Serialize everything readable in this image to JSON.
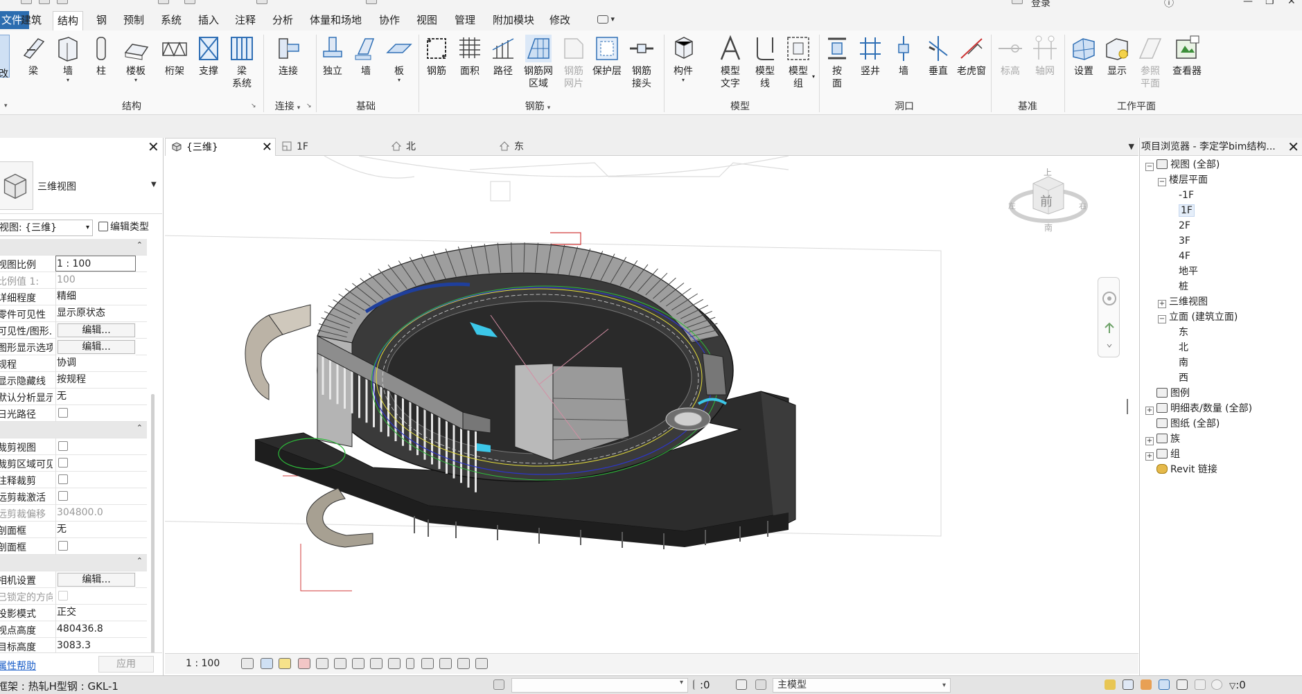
{
  "title_bar": {
    "login": "登录"
  },
  "ribbon_tabs": [
    {
      "label": "文件"
    },
    {
      "label": "建筑"
    },
    {
      "label": "结构"
    },
    {
      "label": "钢"
    },
    {
      "label": "预制"
    },
    {
      "label": "系统"
    },
    {
      "label": "插入"
    },
    {
      "label": "注释"
    },
    {
      "label": "分析"
    },
    {
      "label": "体量和场地"
    },
    {
      "label": "协作"
    },
    {
      "label": "视图"
    },
    {
      "label": "管理"
    },
    {
      "label": "附加模块"
    },
    {
      "label": "修改"
    }
  ],
  "active_tab": "结构",
  "ribbon": {
    "buttons": {
      "modify": "改",
      "beam": "梁",
      "wall": "墙",
      "column": "柱",
      "floor": "楼板",
      "truss": "桁架",
      "brace": "支撑",
      "beam_system": "梁\n系统",
      "connection": "连接",
      "isolated": "独立",
      "fnd_wall": "墙",
      "fnd_slab": "板",
      "rebar": "钢筋",
      "area": "面积",
      "path": "路径",
      "fabric_area": "钢筋网\n区域",
      "fabric_sheet": "钢筋\n网片",
      "cover": "保护层",
      "coupler": "钢筋\n接头",
      "component": "构件",
      "model_text": "模型\n文字",
      "model_line": "模型\n线",
      "model_group": "模型\n组",
      "by_face": "按\n面",
      "shaft": "竖井",
      "op_wall": "墙",
      "vertical": "垂直",
      "dormer": "老虎窗",
      "level": "标高",
      "grid": "轴网",
      "set": "设置",
      "show": "显示",
      "ref_plane": "参照\n平面",
      "viewer": "查看器"
    },
    "groups": {
      "structure": "结构",
      "connection": "连接",
      "foundation": "基础",
      "reinforcement": "钢筋",
      "model": "模型",
      "opening": "洞口",
      "datum": "基准",
      "work_plane": "工作平面"
    }
  },
  "properties": {
    "type_name": "三维视图",
    "filter": "视图: {三维}",
    "edit_type": "编辑类型",
    "rows": [
      {
        "kind": "section"
      },
      {
        "label": "视图比例",
        "value": "1 : 100",
        "style": "input"
      },
      {
        "label": "比例值 1:",
        "value": "100",
        "style": "grey"
      },
      {
        "label": "详细程度",
        "value": "精细"
      },
      {
        "label": "零件可见性",
        "value": "显示原状态"
      },
      {
        "label": "可见性/图形...",
        "value": "编辑...",
        "style": "btn"
      },
      {
        "label": "图形显示选项",
        "value": "编辑...",
        "style": "btn"
      },
      {
        "label": "规程",
        "value": "协调"
      },
      {
        "label": "显示隐藏线",
        "value": "按规程"
      },
      {
        "label": "默认分析显示...",
        "value": "无"
      },
      {
        "label": "日光路径",
        "value": "",
        "style": "checkbox"
      },
      {
        "kind": "section"
      },
      {
        "label": "裁剪视图",
        "value": "",
        "style": "checkbox"
      },
      {
        "label": "裁剪区域可见",
        "value": "",
        "style": "checkbox"
      },
      {
        "label": "注释裁剪",
        "value": "",
        "style": "checkbox"
      },
      {
        "label": "远剪裁激活",
        "value": "",
        "style": "checkbox"
      },
      {
        "label": "远剪裁偏移",
        "value": "304800.0",
        "style": "grey"
      },
      {
        "label": "剖面框",
        "value": "无"
      },
      {
        "label": "剖面框",
        "value": "",
        "style": "checkbox"
      },
      {
        "kind": "section"
      },
      {
        "label": "相机设置",
        "value": "编辑...",
        "style": "btn"
      },
      {
        "label": "已锁定的方向",
        "value": "",
        "style": "greycheck"
      },
      {
        "label": "投影模式",
        "value": "正交"
      },
      {
        "label": "视点高度",
        "value": "480436.8"
      },
      {
        "label": "目标高度",
        "value": "3083.3"
      }
    ],
    "help": "属性帮助",
    "apply": "应用"
  },
  "view_tabs": [
    {
      "label": "{三维}",
      "active": true
    },
    {
      "label": "1F"
    },
    {
      "label": "北"
    },
    {
      "label": "东"
    }
  ],
  "viewcube": {
    "face": "前",
    "top": "上",
    "left": "左",
    "right": "右",
    "bottom": "南"
  },
  "view_bar": {
    "scale": "1 : 100"
  },
  "project_browser": {
    "title": "项目浏览器 - 李定学bim结构...",
    "nodes": [
      {
        "label": "视图 (全部)",
        "level": 0,
        "toggle": "-",
        "icon": true
      },
      {
        "label": "楼层平面",
        "level": 1,
        "toggle": "-"
      },
      {
        "label": "-1F",
        "level": 2
      },
      {
        "label": "1F",
        "level": 2,
        "selected": true
      },
      {
        "label": "2F",
        "level": 2
      },
      {
        "label": "3F",
        "level": 2
      },
      {
        "label": "4F",
        "level": 2
      },
      {
        "label": "地平",
        "level": 2
      },
      {
        "label": "桩",
        "level": 2
      },
      {
        "label": "三维视图",
        "level": 1,
        "toggle": "+"
      },
      {
        "label": "立面 (建筑立面)",
        "level": 1,
        "toggle": "-"
      },
      {
        "label": "东",
        "level": 2
      },
      {
        "label": "北",
        "level": 2
      },
      {
        "label": "南",
        "level": 2
      },
      {
        "label": "西",
        "level": 2
      },
      {
        "label": "图例",
        "level": 0,
        "icon": true
      },
      {
        "label": "明细表/数量 (全部)",
        "level": 0,
        "toggle": "+",
        "icon": true
      },
      {
        "label": "图纸 (全部)",
        "level": 0,
        "icon": true
      },
      {
        "label": "族",
        "level": 0,
        "toggle": "+",
        "icon": true
      },
      {
        "label": "组",
        "level": 0,
        "toggle": "+",
        "icon": true
      },
      {
        "label": "Revit 链接",
        "level": 0,
        "icon": true
      }
    ]
  },
  "status_bar": {
    "message": "框架 : 热轧H型钢 : GKL-1",
    "selection_count": ":0",
    "model": "主模型",
    "filter_count": ":0"
  },
  "colors": {
    "file_tab": "#2c6db0",
    "selection": "#e5eef9",
    "model_dark": "#3a3a3a"
  }
}
